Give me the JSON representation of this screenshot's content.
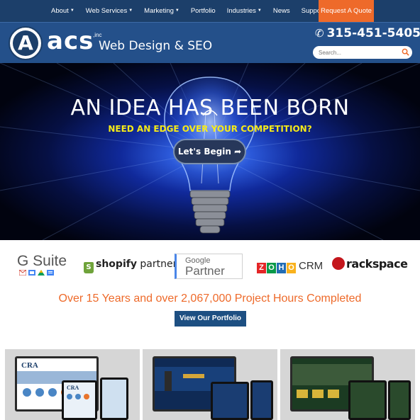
{
  "nav": {
    "items": [
      {
        "label": "About",
        "dropdown": true
      },
      {
        "label": "Web Services",
        "dropdown": true
      },
      {
        "label": "Marketing",
        "dropdown": true
      },
      {
        "label": "Portfolio",
        "dropdown": false
      },
      {
        "label": "Industries",
        "dropdown": true
      },
      {
        "label": "News",
        "dropdown": false
      },
      {
        "label": "Support",
        "dropdown": true
      }
    ],
    "quote_label": "Request A Quote"
  },
  "header": {
    "logo_letter": "A",
    "brand": "acs",
    "brand_suffix": ",inc",
    "brand_sub": "Web Design & SEO",
    "phone": "315-451-5405",
    "search_placeholder": "Search..."
  },
  "hero": {
    "title": "AN IDEA HAS BEEN BORN",
    "subtitle": "NEED  AN EDGE OVER YOUR COMPETITION?",
    "cta_label": "Let's Begin"
  },
  "partners": {
    "gsuite": "G Suite",
    "shopify_brand": "shopify",
    "shopify_word": "partners",
    "google_line1": "Google",
    "google_line2": "Partner",
    "zoho_letters": [
      "Z",
      "O",
      "H",
      "O"
    ],
    "zoho_crm": "CRM",
    "rackspace": "rackspace"
  },
  "tagline": "Over 15 Years and over 2,067,000 Project Hours Completed",
  "portfolio_button": "View Our Portfolio",
  "cards": [
    {
      "screen_label": "CRA"
    },
    {
      "screen_label": ""
    },
    {
      "screen_label": ""
    }
  ],
  "colors": {
    "nav_bg": "#1c3f6a",
    "header_bg": "#24508a",
    "accent_orange": "#ee6a2a",
    "hero_yellow": "#f6ea18",
    "button_blue": "#1d4f82"
  }
}
